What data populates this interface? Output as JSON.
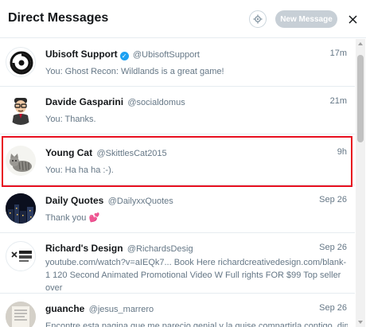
{
  "header": {
    "title": "Direct Messages",
    "new_message_label": "New Message",
    "settings_icon": "gear-icon",
    "close_icon": "close-icon"
  },
  "conversations": [
    {
      "name": "Ubisoft Support",
      "verified": true,
      "handle": "@UbisoftSupport",
      "time": "17m",
      "preview": "You: Ghost Recon: Wildlands is a great game!",
      "avatar": "ubisoft-logo"
    },
    {
      "name": "Davide Gasparini",
      "handle": "@socialdomus",
      "time": "21m",
      "preview": "You: Thanks.",
      "avatar": "cartoon-man-with-glasses"
    },
    {
      "name": "Young Cat",
      "handle": "@SkittlesCat2015",
      "time": "9h",
      "preview": "You: Ha ha ha :-).",
      "avatar": "tabby-cat",
      "highlighted": true
    },
    {
      "name": "Daily Quotes",
      "handle": "@DailyxxQuotes",
      "time": "Sep 26",
      "preview": "Thank you",
      "preview_emoji": "💕",
      "avatar": "night-city-photo"
    },
    {
      "name": "Richard's Design",
      "handle": "@RichardsDesig",
      "time": "Sep 26",
      "preview": "youtube.com/watch?v=aIEQk7... Book Here richardcreativedesign.com/blank-1 120 Second Animated Promotional Video W Full rights FOR $99 Top seller over",
      "avatar": "richards-creative-logo"
    },
    {
      "name": "guanche",
      "handle": "@jesus_marrero",
      "time": "Sep 26",
      "preview": "Encontre esta pagina que me parecio genial y la quise compartirla contigo. dime",
      "avatar": "document-photo"
    }
  ],
  "colors": {
    "highlight_border": "#e81020",
    "verified_badge": "#1da1f2",
    "secondary_text": "#657786",
    "new_message_button": "#c7cfd6"
  }
}
